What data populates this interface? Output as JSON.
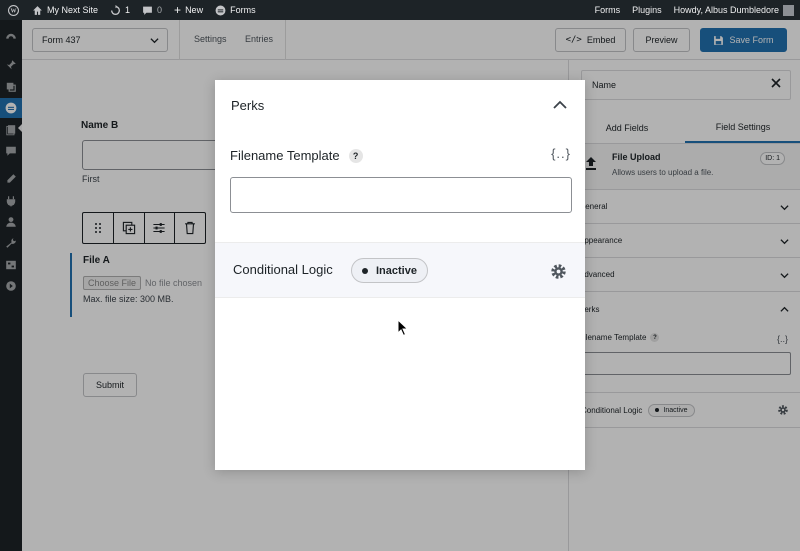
{
  "admin_bar": {
    "site_name": "My Next Site",
    "updates_count": "1",
    "comments_count": "0",
    "new_label": "New",
    "forms_label": "Forms",
    "right_forms": "Forms",
    "right_plugins": "Plugins",
    "howdy": "Howdy, Albus Dumbledore"
  },
  "toolbar": {
    "form_select": "Form 437",
    "settings_link": "Settings",
    "entries_link": "Entries",
    "embed_label": "Embed",
    "preview_label": "Preview",
    "save_label": "Save Form"
  },
  "canvas": {
    "name_label": "Name B",
    "first_sublabel": "First",
    "file_label": "File A",
    "choose_file": "Choose File",
    "no_file": "No file chosen",
    "max_size": "Max. file size: 300 MB.",
    "submit_label": "Submit"
  },
  "sidebar": {
    "search_value": "Name",
    "tabs": [
      {
        "label": "Add Fields"
      },
      {
        "label": "Field Settings"
      }
    ],
    "field_title": "File Upload",
    "field_desc": "Allows users to upload a file.",
    "field_id": "ID: 1",
    "sections": [
      {
        "label": "General"
      },
      {
        "label": "Appearance"
      },
      {
        "label": "Advanced"
      },
      {
        "label": "Perks"
      }
    ],
    "filename_label": "Filename Template",
    "help_mark": "?",
    "brace": "{..}",
    "cond_label": "Conditional Logic",
    "cond_status": "Inactive"
  },
  "modal": {
    "title": "Perks",
    "filename_label": "Filename Template",
    "help_mark": "?",
    "merge_tag_button": "{..}",
    "filename_value": "",
    "cond_label": "Conditional Logic",
    "cond_status": "Inactive"
  },
  "colors": {
    "primary": "#2271b1",
    "admin_dark": "#1d2327"
  }
}
